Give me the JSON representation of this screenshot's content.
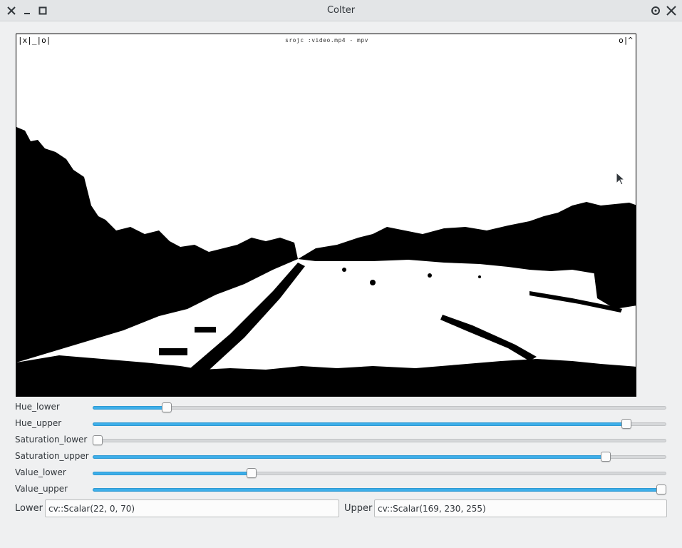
{
  "window": {
    "title": "Colter",
    "controls_left": [
      "close-icon",
      "minimize-icon",
      "maximize-icon"
    ],
    "controls_right": [
      "pin-icon",
      "close-icon"
    ]
  },
  "viewer": {
    "window_label": "srojc :video.mp4 - mpv",
    "corner_left": "|x|_|o|",
    "corner_right": "o|^"
  },
  "sliders": [
    {
      "label": "Hue_lower",
      "value": 0.128
    },
    {
      "label": "Hue_upper",
      "value": 0.932
    },
    {
      "label": "Saturation_lower",
      "value": 0.0
    },
    {
      "label": "Saturation_upper",
      "value": 0.895
    },
    {
      "label": "Value_lower",
      "value": 0.277
    },
    {
      "label": "Value_upper",
      "value": 1.0
    }
  ],
  "lower": {
    "label": "Lower",
    "value": "cv::Scalar(22, 0, 70)"
  },
  "upper": {
    "label": "Upper",
    "value": "cv::Scalar(169, 230, 255)"
  },
  "colors": {
    "accent": "#3daee9",
    "background": "#eff0f1"
  }
}
